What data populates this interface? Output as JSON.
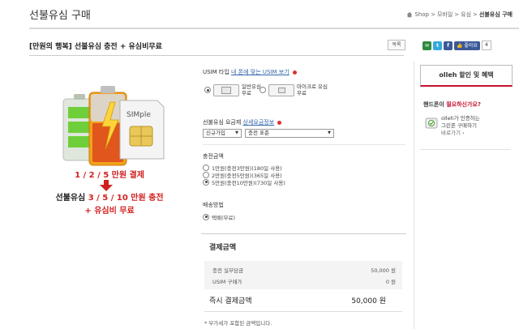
{
  "header": {
    "title": "선불유심 구매",
    "breadcrumb": [
      "Shop",
      "모바일",
      "유심",
      "선불유심 구매"
    ]
  },
  "product": {
    "title": "[만원의 행복] 선불유심 충전 + 유심비무료",
    "list_button": "목록"
  },
  "sns": {
    "like_label": "좋아요",
    "like_count": "4"
  },
  "promo": {
    "line1": "1 / 2 / 5 만원 결제",
    "line2_prefix": "선불유심 ",
    "line2_red": "3 / 5 / 10 만원 충전",
    "line3": "+ 유심비 무료",
    "card_label": "SIMple"
  },
  "usim_type": {
    "label": "USIM 타입",
    "link": "내 폰에 맞는 USIM 보기",
    "options": [
      {
        "line1": "일반유심",
        "line2": "무료",
        "selected": true
      },
      {
        "line1": "마이크로 유심",
        "line2": "무료",
        "selected": false
      }
    ]
  },
  "plan": {
    "label": "선불유심 요금제",
    "link": "상세요금정보",
    "select1": "신규가입",
    "select2": "충전 표준"
  },
  "charge": {
    "label": "충전금액",
    "options": [
      {
        "text": "1만원(충전3만원)(180일 사용)",
        "selected": false
      },
      {
        "text": "2만원(충전5만원)(365일 사용)",
        "selected": false
      },
      {
        "text": "5만원(충전10만원)(730일 사용)",
        "selected": true
      }
    ]
  },
  "delivery": {
    "label": "배송방법",
    "option": "택배(무료)"
  },
  "payment": {
    "title": "결제금액",
    "rows": [
      {
        "label": "충전 실부담금",
        "value": "50,000 원"
      },
      {
        "label": "USIM 구매가",
        "value": "0 원"
      }
    ],
    "total_label": "즉시 결제금액",
    "total_value": "50,000 원",
    "vat_note": "* 부가세가 포함된 금액입니다."
  },
  "sidebar": {
    "olleh_button": "olleh 할인 및 혜택",
    "phone_q_prefix": "핸드폰이 ",
    "phone_q_red": "필요하신가요?",
    "cert_line1": "olleh가 인증하는",
    "cert_line2": "그린폰 구매하기",
    "cert_more": "바로가기 ›"
  },
  "colors": {
    "accent_red": "#c41230",
    "link_blue": "#3366aa",
    "facebook": "#3b5998"
  }
}
